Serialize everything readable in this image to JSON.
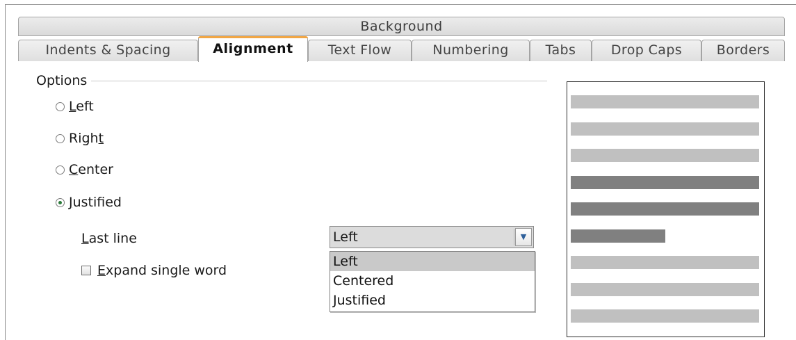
{
  "tabs": {
    "background_label": "Background",
    "items": [
      {
        "label": "Indents & Spacing",
        "active": false
      },
      {
        "label": "Alignment",
        "active": true
      },
      {
        "label": "Text Flow",
        "active": false
      },
      {
        "label": "Numbering",
        "active": false
      },
      {
        "label": "Tabs",
        "active": false
      },
      {
        "label": "Drop Caps",
        "active": false
      },
      {
        "label": "Borders",
        "active": false
      }
    ]
  },
  "options": {
    "section_label": "Options",
    "radios": [
      {
        "pre": "",
        "mnemonic": "L",
        "post": "eft",
        "checked": false
      },
      {
        "pre": "Righ",
        "mnemonic": "t",
        "post": "",
        "checked": false
      },
      {
        "pre": "",
        "mnemonic": "C",
        "post": "enter",
        "checked": false
      },
      {
        "pre": "",
        "mnemonic": "J",
        "post": "ustified",
        "checked": true
      }
    ],
    "last_line": {
      "label_mnemonic": "L",
      "label_rest": "ast line",
      "selected": "Left",
      "options": [
        "Left",
        "Centered",
        "Justified"
      ]
    },
    "expand_single_word": {
      "label_mnemonic": "E",
      "label_rest": "xpand single word",
      "checked": false
    }
  },
  "preview": {
    "lines": [
      "light",
      "light",
      "light",
      "dark",
      "dark",
      "dark",
      "light",
      "light",
      "light"
    ],
    "last_line_fraction": 0.5
  },
  "colors": {
    "active_tab_accent": "#f0a646",
    "preview_light": "#c0c0c0",
    "preview_dark": "#808080"
  }
}
